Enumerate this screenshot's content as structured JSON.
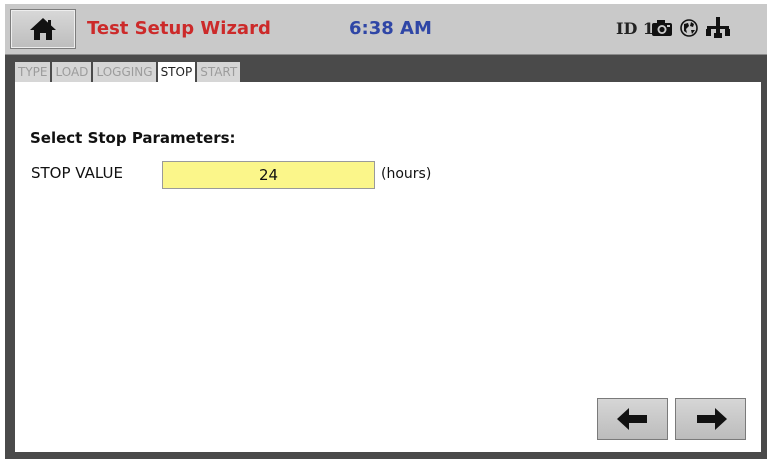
{
  "header": {
    "title": "Test Setup Wizard",
    "time": "6:38 AM",
    "device_id": "ID 1",
    "icons": [
      "home-icon",
      "camera-icon",
      "network-icon",
      "usb-icon"
    ],
    "colors": {
      "title": "#cc2a2a",
      "time": "#2f46a6",
      "bar": "#c9c9c9"
    }
  },
  "tabs": [
    {
      "label": "TYPE",
      "active": false
    },
    {
      "label": "LOAD",
      "active": false
    },
    {
      "label": "LOGGING",
      "active": false
    },
    {
      "label": "STOP",
      "active": true
    },
    {
      "label": "START",
      "active": false
    }
  ],
  "stop": {
    "heading": "Select Stop Parameters:",
    "field_label": "STOP VALUE",
    "value": "24",
    "units": "(hours)",
    "input_color": "#fbf68a"
  },
  "nav": {
    "back_icon": "arrow-left-icon",
    "next_icon": "arrow-right-icon"
  }
}
